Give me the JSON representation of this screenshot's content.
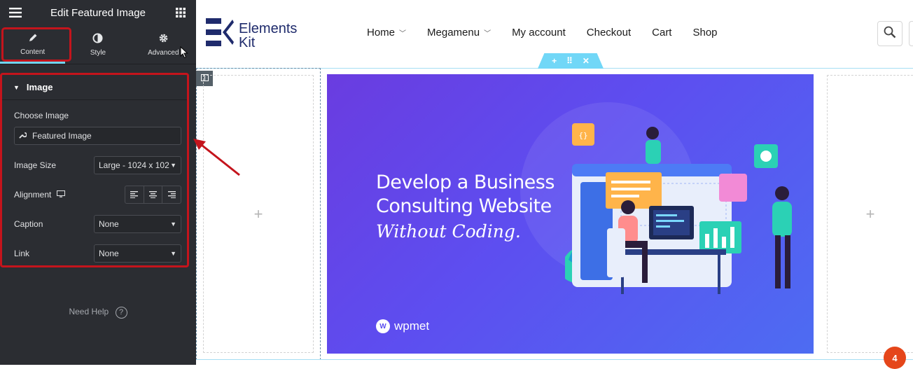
{
  "panel": {
    "title": "Edit Featured Image",
    "tabs": [
      {
        "label": "Content",
        "icon": "pencil-icon"
      },
      {
        "label": "Style",
        "icon": "contrast-icon"
      },
      {
        "label": "Advanced",
        "icon": "gear-icon"
      }
    ],
    "section_title": "Image",
    "choose_image_label": "Choose Image",
    "choose_image_value": "Featured Image",
    "image_size_label": "Image Size",
    "image_size_value": "Large - 1024 x 102",
    "alignment_label": "Alignment",
    "caption_label": "Caption",
    "caption_value": "None",
    "link_label": "Link",
    "link_value": "None",
    "need_help": "Need Help",
    "help_icon_text": "?"
  },
  "site": {
    "logo_line1": "Elements",
    "logo_line2": "Kit",
    "nav": [
      "Home",
      "Megamenu",
      "My account",
      "Checkout",
      "Cart",
      "Shop"
    ]
  },
  "hero": {
    "line1": "Develop a Business",
    "line2": "Consulting Website",
    "line3": "Without Coding.",
    "brand": "wpmet"
  },
  "badge_count": "4",
  "colors": {
    "panel_bg": "#2b2d32",
    "highlight": "#c4141c",
    "accent": "#71d7f7",
    "hero_purple": "#6a3ce0",
    "badge": "#e5461a"
  }
}
